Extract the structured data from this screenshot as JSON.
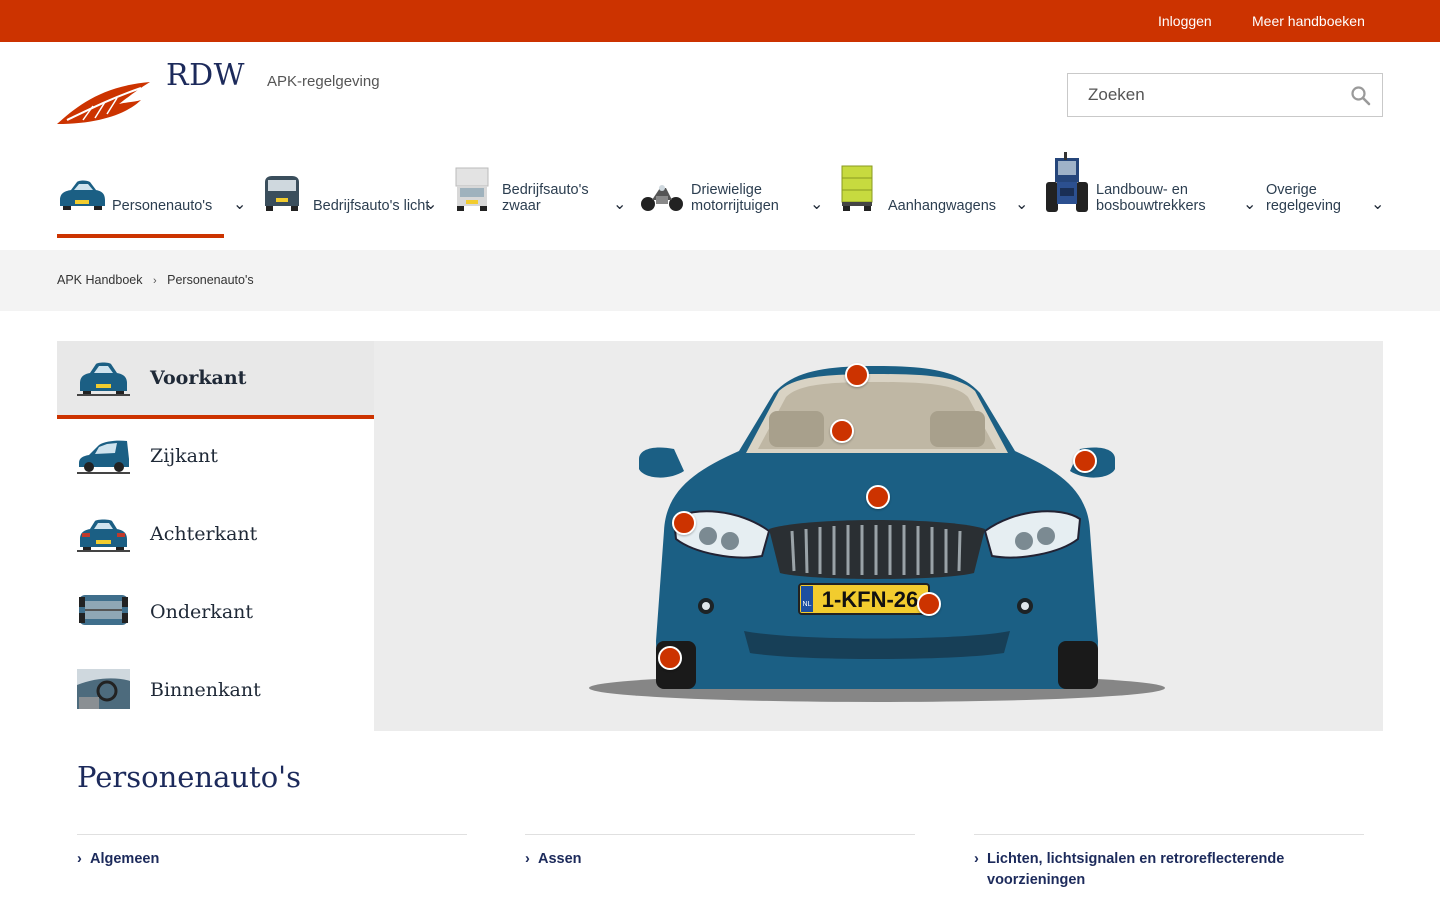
{
  "topbar": {
    "login": "Inloggen",
    "more": "Meer handboeken"
  },
  "header": {
    "logo": "RDW",
    "subtitle": "APK-regelgeving",
    "search_placeholder": "Zoeken"
  },
  "nav": [
    {
      "label": "Personenauto's",
      "icon": "car-icon",
      "active": true
    },
    {
      "label": "Bedrijfsauto's licht",
      "icon": "van-icon"
    },
    {
      "label": "Bedrijfsauto's zwaar",
      "icon": "truck-icon"
    },
    {
      "label": "Driewielige motorrijtuigen",
      "icon": "trike-icon"
    },
    {
      "label": "Aanhangwagens",
      "icon": "trailer-icon"
    },
    {
      "label": "Landbouw- en bosbouwtrekkers",
      "icon": "tractor-icon"
    },
    {
      "label": "Overige regelgeving",
      "icon": ""
    }
  ],
  "breadcrumb": {
    "home": "APK Handboek",
    "current": "Personenauto's"
  },
  "views": [
    {
      "label": "Voorkant",
      "active": true
    },
    {
      "label": "Zijkant"
    },
    {
      "label": "Achterkant"
    },
    {
      "label": "Onderkant"
    },
    {
      "label": "Binnenkant"
    }
  ],
  "car": {
    "plate": "1-KFN-26",
    "plate_country": "NL",
    "color": "#1b5f84"
  },
  "section": {
    "title": "Personenauto's",
    "columns": [
      [
        "Algemeen"
      ],
      [
        "Assen"
      ],
      [
        "Lichten, lichtsignalen en retroreflecterende voorzieningen"
      ]
    ]
  },
  "colors": {
    "brand": "#cc3300",
    "navy": "#1c2a5b",
    "car_blue": "#1b5f84"
  }
}
